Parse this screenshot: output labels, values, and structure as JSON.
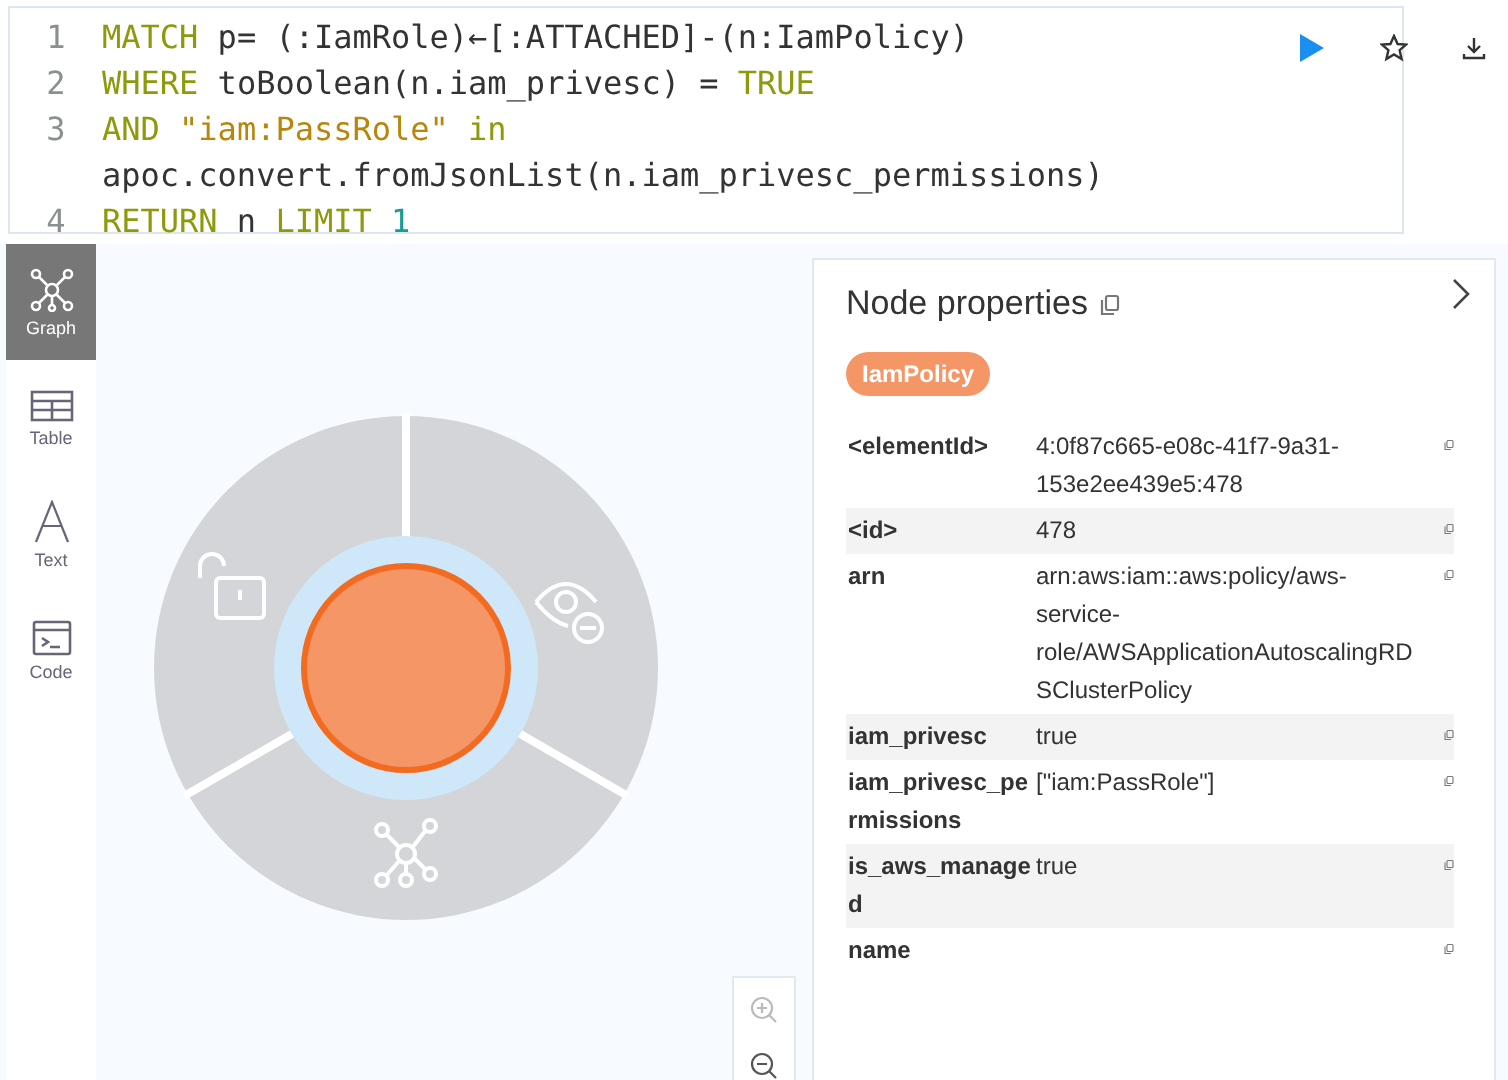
{
  "editor": {
    "lines": [
      {
        "number": "1",
        "tokens": [
          {
            "text": "MATCH",
            "kind": "keyword"
          },
          {
            "text": " p= (:IamRole)←[:ATTACHED]-(n:IamPolicy)",
            "kind": "plain"
          }
        ]
      },
      {
        "number": "2",
        "tokens": [
          {
            "text": "WHERE",
            "kind": "keyword"
          },
          {
            "text": " toBoolean(n.iam_privesc) = ",
            "kind": "plain"
          },
          {
            "text": "TRUE",
            "kind": "keyword"
          }
        ]
      },
      {
        "number": "3",
        "tokens": [
          {
            "text": "AND",
            "kind": "keyword"
          },
          {
            "text": " \"iam:PassRole\"",
            "kind": "string"
          },
          {
            "text": " in",
            "kind": "keyword"
          }
        ]
      },
      {
        "tokens": [
          {
            "text": "apoc.convert.fromJsonList(n.iam_privesc_permissions)",
            "kind": "plain"
          }
        ]
      },
      {
        "number": "4",
        "tokens": [
          {
            "text": "RETURN",
            "kind": "keyword"
          },
          {
            "text": " n ",
            "kind": "plain"
          },
          {
            "text": "LIMIT",
            "kind": "keyword"
          },
          {
            "text": " 1",
            "kind": "number"
          }
        ]
      }
    ]
  },
  "views": [
    {
      "label": "Graph",
      "kind": "graph",
      "selected": true
    },
    {
      "label": "Table",
      "kind": "table",
      "selected": false
    },
    {
      "label": "Text",
      "kind": "text",
      "selected": false
    },
    {
      "label": "Code",
      "kind": "code",
      "selected": false
    }
  ],
  "panel": {
    "title": "Node properties",
    "label": "IamPolicy",
    "properties": [
      {
        "key": "<elementId>",
        "value": "4:0f87c665-e08c-41f7-9a31-153e2ee439e5:478"
      },
      {
        "key": "<id>",
        "value": "478"
      },
      {
        "key": "arn",
        "value": "arn:aws:iam::aws:policy/aws-service-role/AWSApplicationAutoscalingRDSClusterPolicy"
      },
      {
        "key": "iam_privesc",
        "value": "true"
      },
      {
        "key": "iam_privesc_permissions",
        "value": "[\"iam:PassRole\"]"
      },
      {
        "key": "is_aws_managed",
        "value": "true"
      },
      {
        "key": "name"
      }
    ]
  }
}
